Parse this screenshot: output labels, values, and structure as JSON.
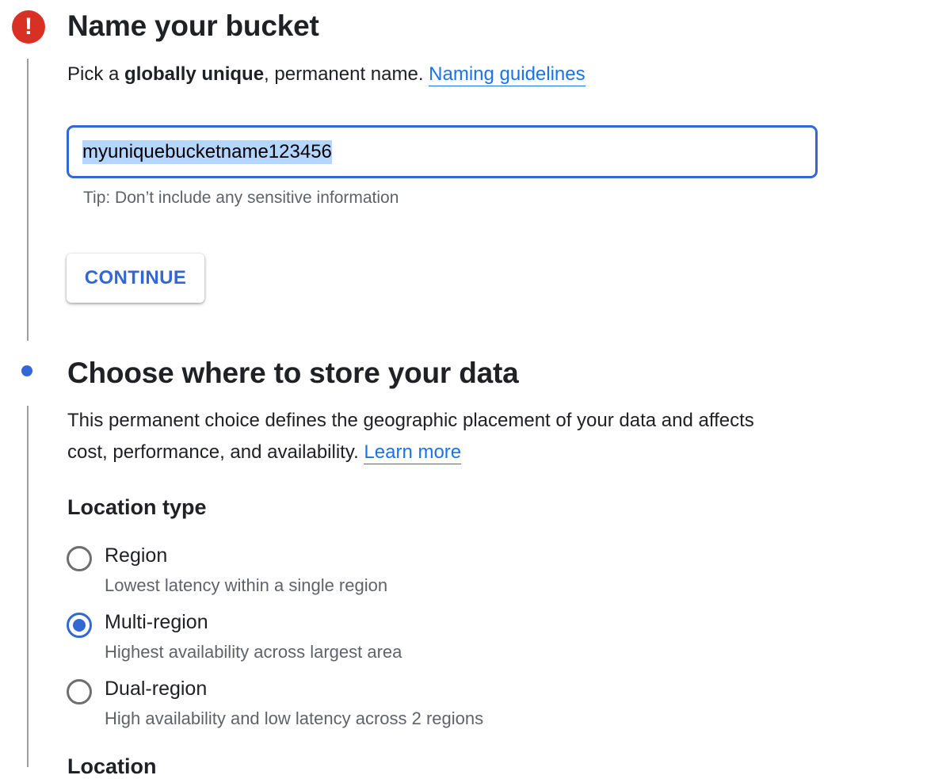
{
  "step_name": {
    "title": "Name your bucket",
    "desc_prefix": "Pick a ",
    "desc_bold": "globally unique",
    "desc_suffix": ", permanent name. ",
    "link": "Naming guidelines",
    "input_value": "myuniquebucketname123456",
    "hint": "Tip: Don’t include any sensitive information",
    "continue_label": "CONTINUE",
    "status": "error"
  },
  "step_location": {
    "title": "Choose where to store your data",
    "desc_line1": "This permanent choice defines the geographic placement of your data and affects",
    "desc_line2": "cost, performance, and availability. ",
    "link": "Learn more",
    "location_type_heading": "Location type",
    "options": [
      {
        "label": "Region",
        "description": "Lowest latency within a single region",
        "selected": false
      },
      {
        "label": "Multi-region",
        "description": "Highest availability across largest area",
        "selected": true
      },
      {
        "label": "Dual-region",
        "description": "High availability and low latency across 2 regions",
        "selected": false
      }
    ],
    "next_heading_partial": "Location"
  },
  "colors": {
    "accent": "#3367d6",
    "link": "#1a73e8",
    "error": "#d93025",
    "selection_highlight": "#b4d5fe",
    "muted_text": "#5f6368"
  },
  "icons": {
    "step1": "error-icon",
    "step2": "current-step-dot"
  }
}
